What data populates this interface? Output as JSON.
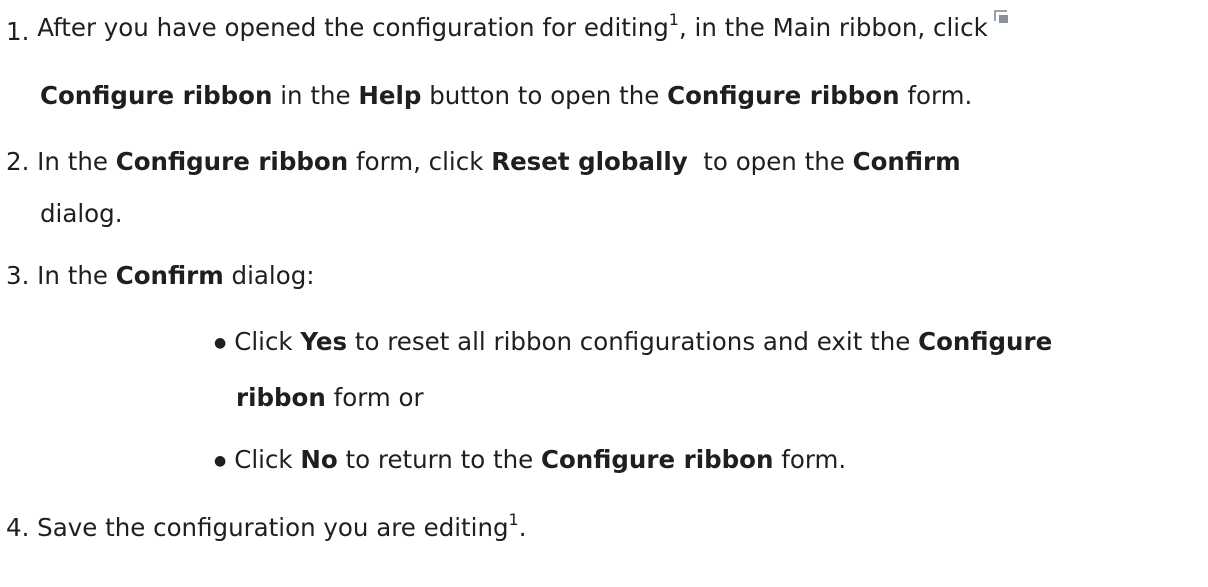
{
  "step1": {
    "num": "1.",
    "t1": "After you have opened the configuration for editing",
    "sup": "1",
    "t2": ", in the Main ribbon, click",
    "icon": "configure-ribbon-icon",
    "b1": "Configure ribbon",
    "t3": " in the ",
    "b2": "Help",
    "t4": " button to open the ",
    "b3": "Configure ribbon",
    "t5": " form."
  },
  "step2": {
    "num": "2.",
    "t1": " In the ",
    "b1": "Configure ribbon",
    "t2": " form, click ",
    "b2": "Reset globally",
    "t3": "  to open the ",
    "b3": "Confirm",
    "t4": "dialog."
  },
  "step3": {
    "num": "3.",
    "t1": " In the ",
    "b1": "Confirm",
    "t2": " dialog:"
  },
  "bullet1": {
    "t1": "Click ",
    "b1": "Yes",
    "t2": " to reset all ribbon configurations and exit the ",
    "b2": "Configure",
    "b3": "ribbon",
    "t3": " form or"
  },
  "bullet2": {
    "t1": "Click ",
    "b1": "No",
    "t2": " to return to the ",
    "b2": "Configure ribbon",
    "t3": " form."
  },
  "step4": {
    "num": "4.",
    "t1": " Save the configuration you are editing",
    "sup": "1",
    "t2": "."
  }
}
